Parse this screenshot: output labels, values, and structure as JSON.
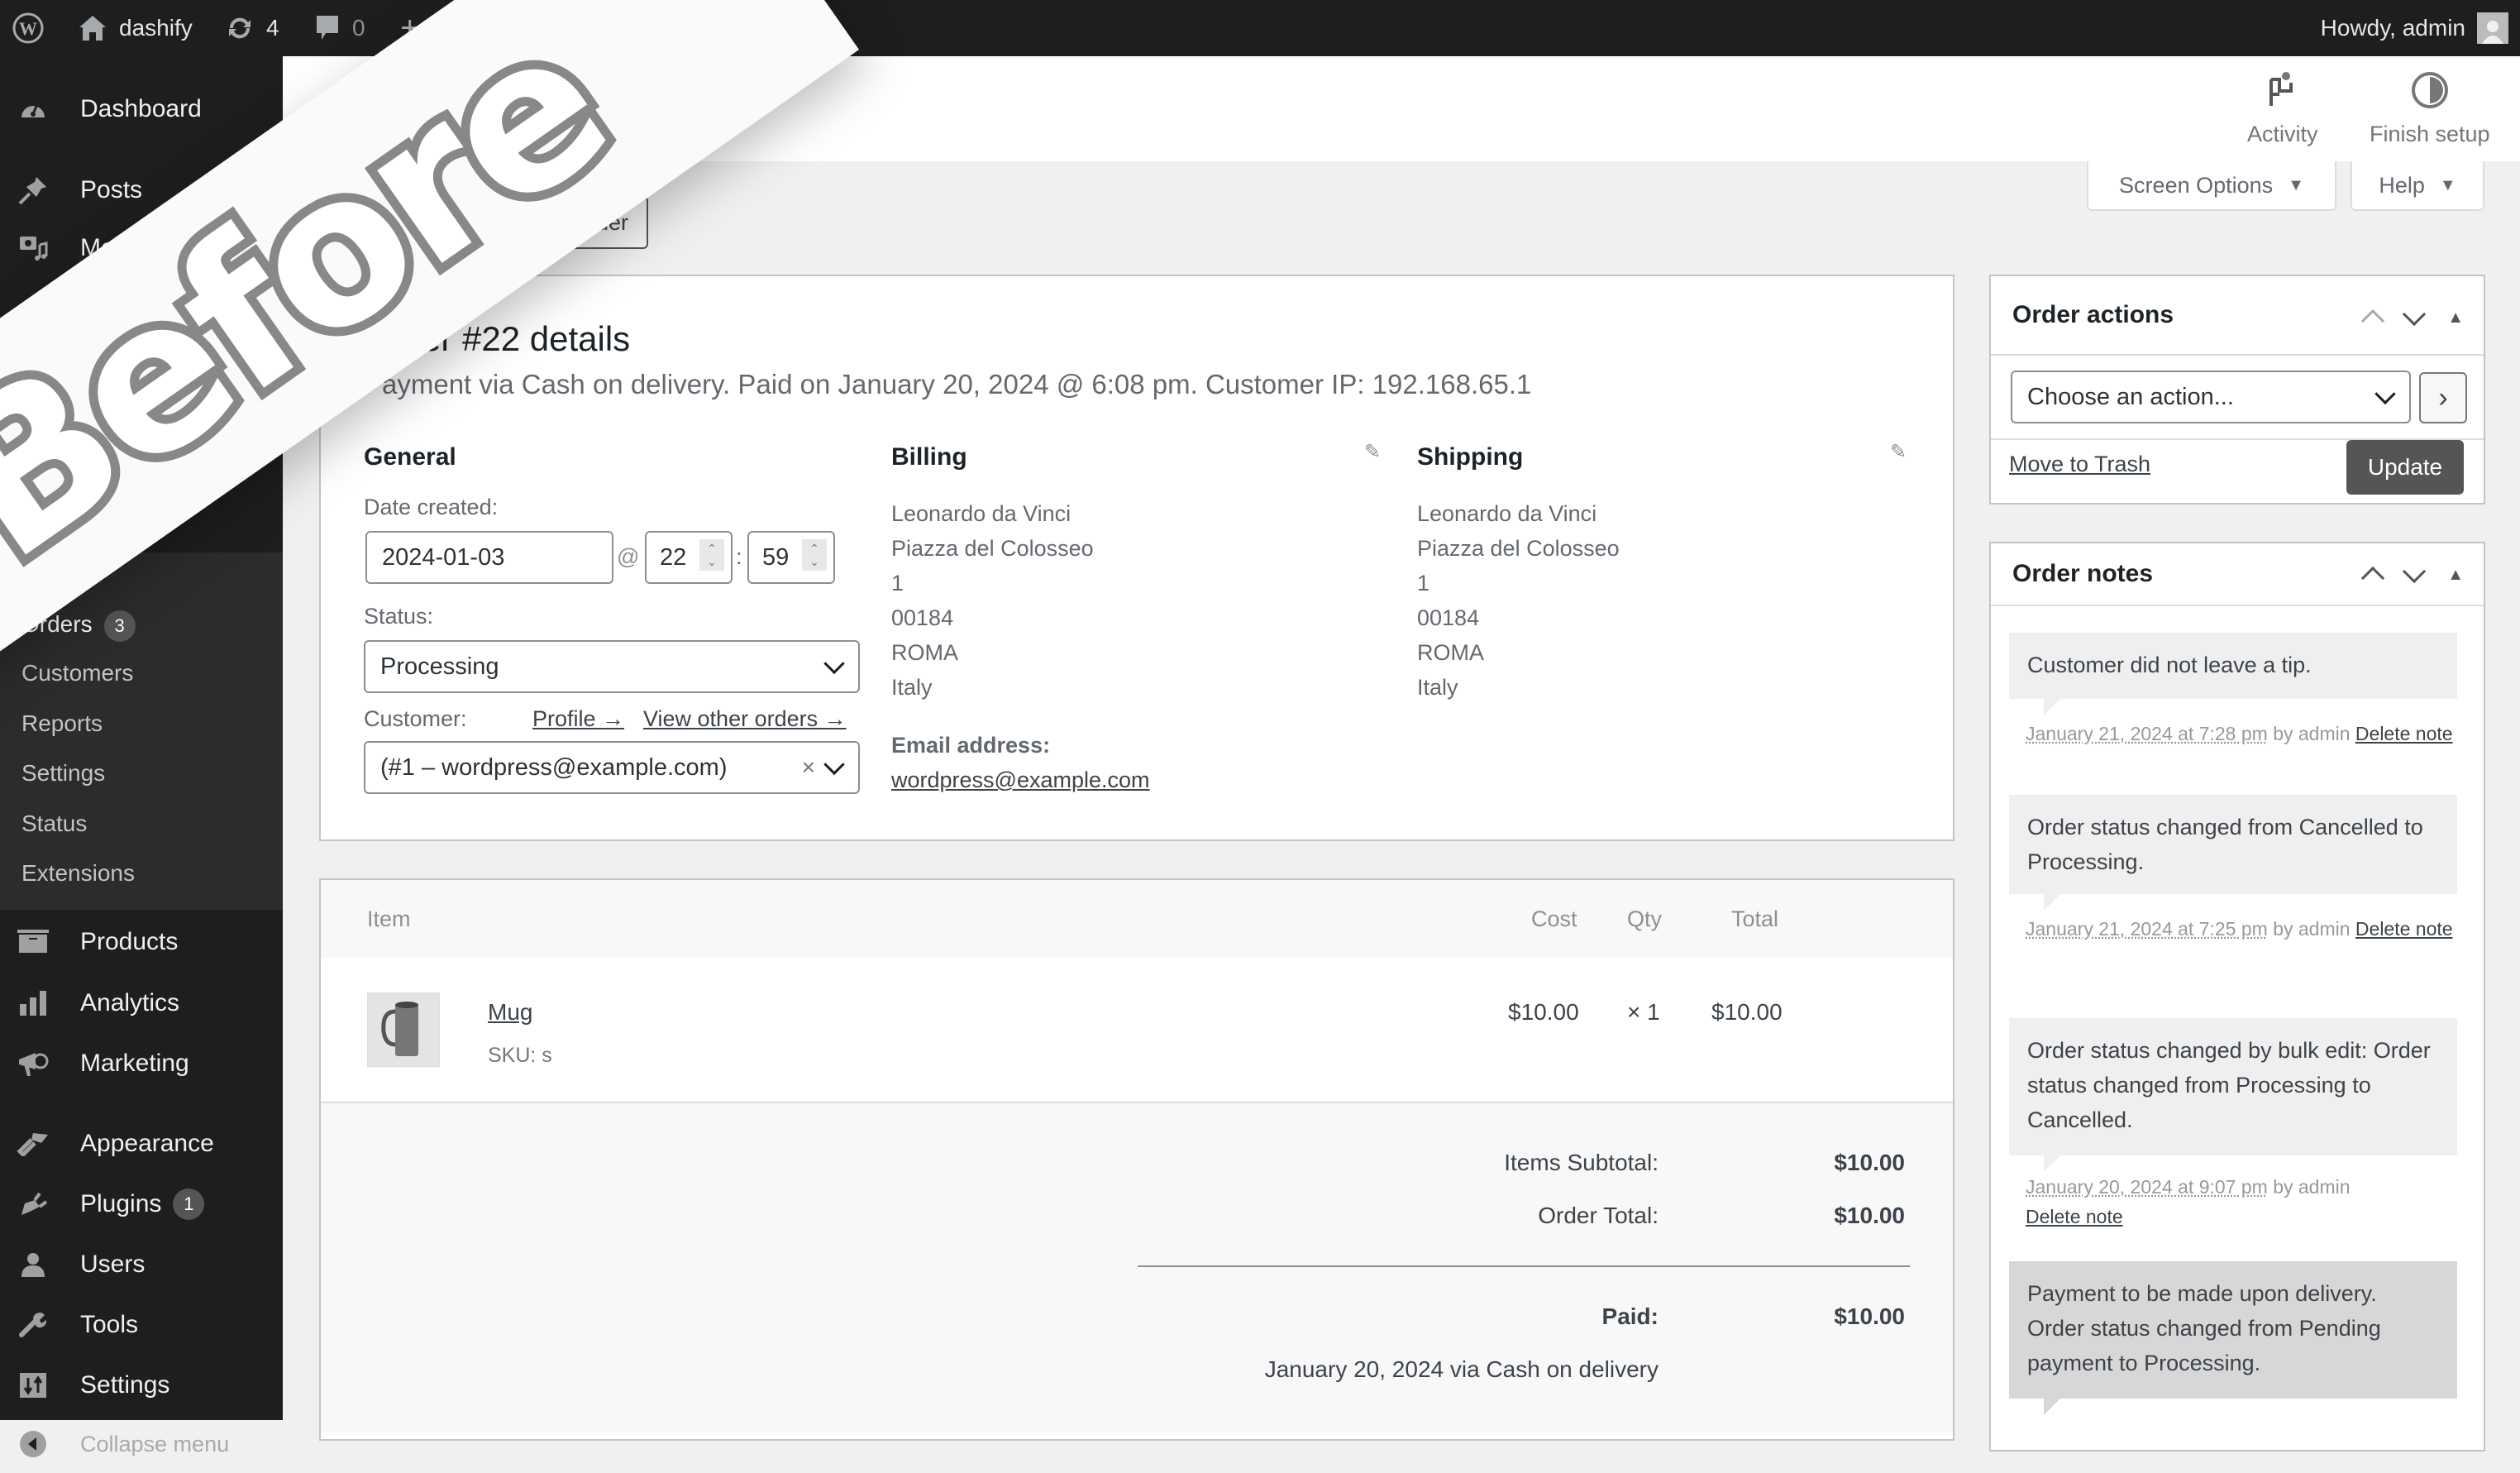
{
  "adminbar": {
    "site_name": "dashify",
    "updates_count": "4",
    "comments_count": "0",
    "new_label": "+",
    "greeting": "Howdy, admin"
  },
  "sidebar": {
    "items": [
      {
        "label": "Dashboard",
        "icon": "dashboard-icon"
      },
      {
        "label": "Posts",
        "icon": "pin-icon"
      },
      {
        "label": "Media",
        "icon": "media-icon"
      },
      {
        "label": "Products",
        "icon": "archive-icon"
      },
      {
        "label": "Analytics",
        "icon": "bar-chart-icon"
      },
      {
        "label": "Marketing",
        "icon": "megaphone-icon"
      },
      {
        "label": "Appearance",
        "icon": "paintbrush-icon"
      },
      {
        "label": "Plugins",
        "icon": "plugin-icon",
        "badge": "1"
      },
      {
        "label": "Users",
        "icon": "user-icon"
      },
      {
        "label": "Tools",
        "icon": "wrench-icon"
      },
      {
        "label": "Settings",
        "icon": "settings-icon"
      },
      {
        "label": "Collapse menu",
        "icon": "collapse-icon"
      }
    ],
    "submenu": {
      "orders": {
        "label": "Orders",
        "badge": "3"
      },
      "items": [
        "Customers",
        "Reports",
        "Settings",
        "Status",
        "Extensions"
      ]
    }
  },
  "header": {
    "activity_label": "Activity",
    "finish_setup_label": "Finish setup",
    "screen_options_label": "Screen Options",
    "help_label": "Help"
  },
  "page": {
    "add_order_label": "Add order"
  },
  "order": {
    "title": "Order #22 details",
    "subtitle": "Payment via Cash on delivery. Paid on January 20, 2024 @ 6:08 pm. Customer IP: 192.168.65.1",
    "general": {
      "heading": "General",
      "date_label": "Date created:",
      "date_value": "2024-01-03",
      "at_sign": "@",
      "hour_value": "22",
      "colon": ":",
      "minute_value": "59",
      "status_label": "Status:",
      "status_value": "Processing",
      "customer_label": "Customer:",
      "profile_link": "Profile →",
      "other_orders_link": "View other orders →",
      "customer_value": "(#1 – wordpress@example.com)",
      "clear_symbol": "×"
    },
    "billing": {
      "heading": "Billing",
      "lines": [
        "Leonardo da Vinci",
        "Piazza del Colosseo",
        "1",
        "00184",
        "ROMA",
        "Italy"
      ],
      "email_label": "Email address:",
      "email_value": "wordpress@example.com"
    },
    "shipping": {
      "heading": "Shipping",
      "lines": [
        "Leonardo da Vinci",
        "Piazza del Colosseo",
        "1",
        "00184",
        "ROMA",
        "Italy"
      ]
    }
  },
  "items": {
    "headers": {
      "item": "Item",
      "cost": "Cost",
      "qty": "Qty",
      "total": "Total"
    },
    "rows": [
      {
        "name": "Mug",
        "sku": "SKU: s",
        "cost": "$10.00",
        "qty": "× 1",
        "total": "$10.00"
      }
    ],
    "totals": {
      "subtotal_label": "Items Subtotal:",
      "subtotal_value": "$10.00",
      "order_total_label": "Order Total:",
      "order_total_value": "$10.00",
      "paid_label": "Paid:",
      "paid_value": "$10.00",
      "paid_note": "January 20, 2024 via Cash on delivery"
    }
  },
  "order_actions": {
    "title": "Order actions",
    "select_value": "Choose an action...",
    "go_symbol": "›",
    "trash_label": "Move to Trash",
    "update_label": "Update"
  },
  "order_notes": {
    "title": "Order notes",
    "notes": [
      {
        "text": "Customer did not leave a tip.",
        "date": "January 21, 2024 at 7:28 pm",
        "by": " by admin ",
        "delete": "Delete note",
        "system": false
      },
      {
        "text": "Order status changed from Cancelled to Processing.",
        "date": "January 21, 2024 at 7:25 pm",
        "by": " by admin ",
        "delete": "Delete note",
        "system": false
      },
      {
        "text": "Order status changed by bulk edit: Order status changed from Processing to Cancelled.",
        "date": "January 20, 2024 at 9:07 pm",
        "by": " by admin",
        "delete": "Delete note",
        "system": false
      },
      {
        "text": "Payment to be made upon delivery. Order status changed from Pending payment to Processing.",
        "system": true
      }
    ]
  },
  "overlay": {
    "banner_text": "Before"
  }
}
